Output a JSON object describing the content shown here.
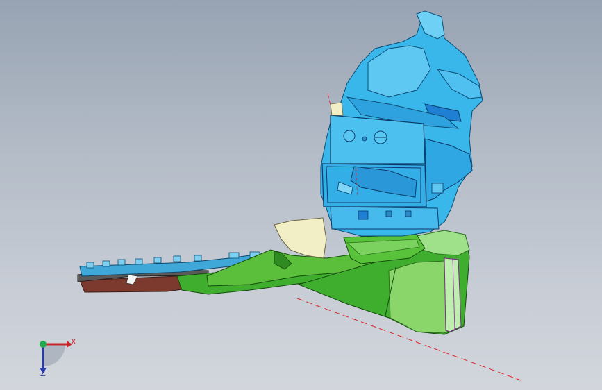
{
  "viewport": {
    "background_top": "#97a3b3",
    "background_bottom": "#d2d6dc"
  },
  "model": {
    "colors": {
      "housing_blue": "#39b6ea",
      "housing_dark_blue": "#1f7fd3",
      "floor_green": "#3fae2f",
      "floor_dark_green": "#2f8a21",
      "tunnel_green": "#8ad66a",
      "panel_cream": "#f2efc6",
      "brown_part": "#7c3a2e",
      "section_line": "#d9262b"
    }
  },
  "triad": {
    "x_label": "X",
    "z_label": "Z",
    "x_color": "#c8242c",
    "y_color": "#23a94a",
    "z_color": "#2a3aa8"
  }
}
